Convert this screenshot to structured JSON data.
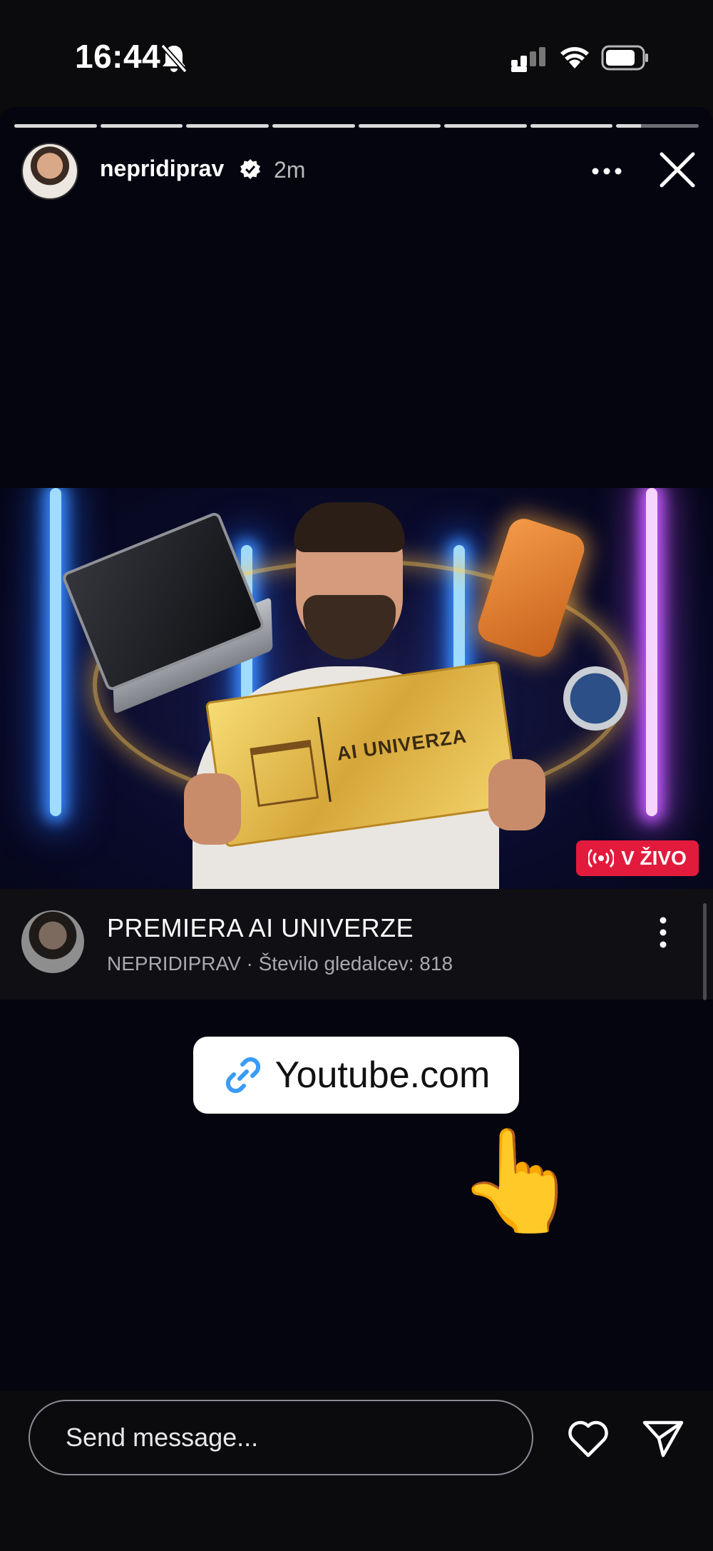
{
  "status_bar": {
    "time": "16:44",
    "icons": [
      "bell-slash-icon",
      "cellular-signal-icon",
      "wifi-icon",
      "battery-icon"
    ]
  },
  "story": {
    "progress": {
      "total_segments": 8,
      "current_segment": 8,
      "current_fraction": 0.3
    },
    "username": "nepridiprav",
    "verified": true,
    "posted_ago": "2m",
    "icons": [
      "more-options-icon",
      "close-icon"
    ]
  },
  "video_card": {
    "thumbnail_text": "AI UNIVERZA",
    "live_badge": "V ŽIVO",
    "title": "PREMIERA AI UNIVERZE",
    "meta": "NEPRIDIPRAV · Število gledalcev: 818"
  },
  "link_sticker": {
    "label": "Youtube.com",
    "icon": "link-icon"
  },
  "pointer_emoji": "👆",
  "footer": {
    "message_placeholder": "Send message...",
    "icons": [
      "heart-icon",
      "send-icon"
    ]
  },
  "colors": {
    "background": "#0b0b0e",
    "live_badge": "#e21b3c",
    "link_icon": "#3b9cf5"
  }
}
